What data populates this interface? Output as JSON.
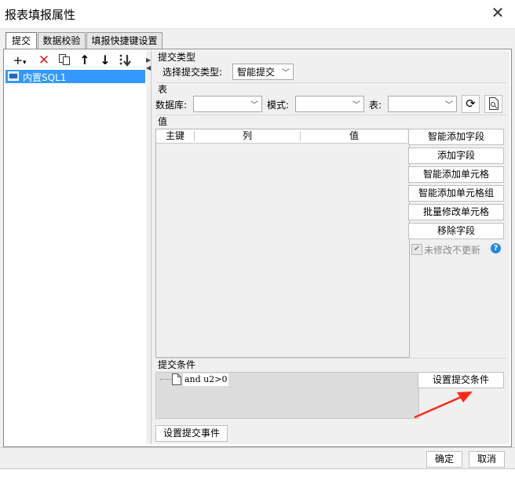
{
  "window": {
    "title": "报表填报属性",
    "close_icon": "close-icon"
  },
  "tabs": [
    {
      "label": "提交"
    },
    {
      "label": "数据校验"
    },
    {
      "label": "填报快捷键设置"
    }
  ],
  "left_panel": {
    "toolbar_icons": [
      "add-dropdown-icon",
      "delete-icon",
      "copy-icon",
      "move-up-icon",
      "move-down-icon",
      "sort-icon"
    ],
    "items": [
      {
        "label": "内置SQL1"
      }
    ]
  },
  "submit_type": {
    "section_title": "提交类型",
    "label": "选择提交类型:",
    "value": "智能提交"
  },
  "table": {
    "section_title": "表",
    "db_label": "数据库:",
    "db_value": "",
    "schema_label": "模式:",
    "schema_value": "",
    "table_label": "表:",
    "table_value": ""
  },
  "values": {
    "section_title": "值",
    "columns": [
      "主键",
      "列",
      "值"
    ],
    "buttons": [
      "智能添加字段",
      "添加字段",
      "智能添加单元格",
      "智能添加单元格组",
      "批量修改单元格",
      "移除字段"
    ],
    "checkbox_label": "未修改不更新",
    "checkbox_checked": true
  },
  "conditions": {
    "section_title": "提交条件",
    "tree_item": "and u2>0",
    "set_button": "设置提交条件"
  },
  "event_button": "设置提交事件",
  "footer": {
    "ok": "确定",
    "cancel": "取消"
  },
  "colors": {
    "selection": "#3399ff",
    "annotation_arrow": "#ff2a1a",
    "help_icon": "#1e88e5"
  }
}
